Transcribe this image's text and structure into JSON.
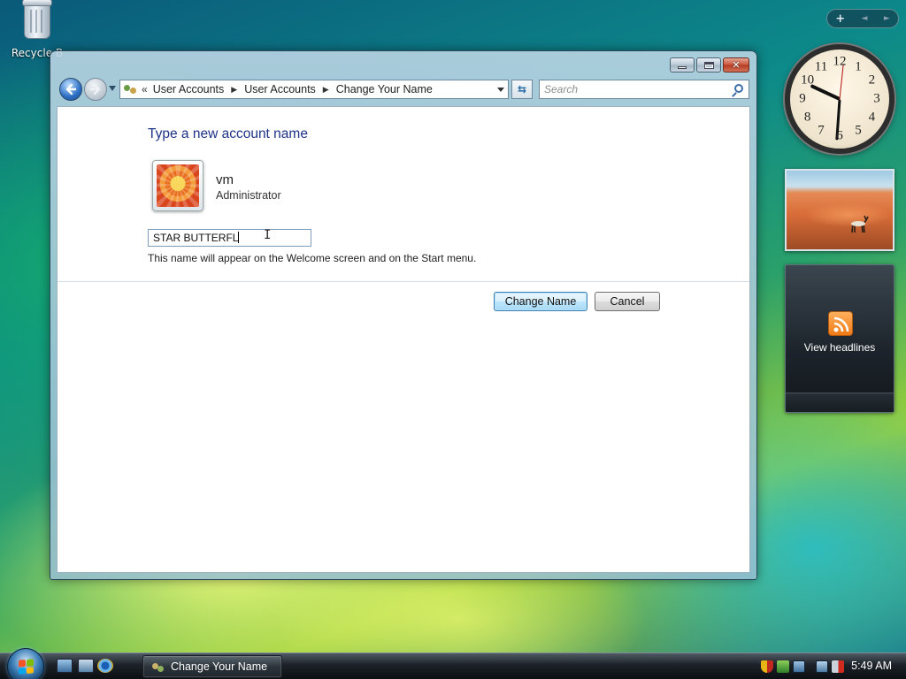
{
  "desktop": {
    "recycle_bin_label": "Recycle B"
  },
  "window": {
    "title_buttons": [
      "minimize",
      "maximize",
      "close"
    ],
    "address": {
      "overflow": "«",
      "crumbs": [
        "User Accounts",
        "User Accounts",
        "Change Your Name"
      ]
    },
    "search_placeholder": "Search",
    "content": {
      "heading": "Type a new account name",
      "user_name": "vm",
      "user_role": "Administrator",
      "name_value": "STAR BUTTERFL",
      "hint": "This name will appear on the Welcome screen and on the Start menu.",
      "change_button": "Change Name",
      "cancel_button": "Cancel"
    }
  },
  "sidebar": {
    "controls": [
      "+",
      "◄",
      "►"
    ],
    "clock_numbers": [
      "12",
      "1",
      "2",
      "3",
      "4",
      "5",
      "6",
      "7",
      "8",
      "9",
      "10",
      "11"
    ],
    "feed_label": "View headlines"
  },
  "taskbar": {
    "task_button_label": "Change Your Name",
    "time": "5:49 AM"
  },
  "colors": {
    "heading": "#1e3287",
    "primary_button_border": "#3c7fb1",
    "feed_orange": "#f07a16"
  }
}
